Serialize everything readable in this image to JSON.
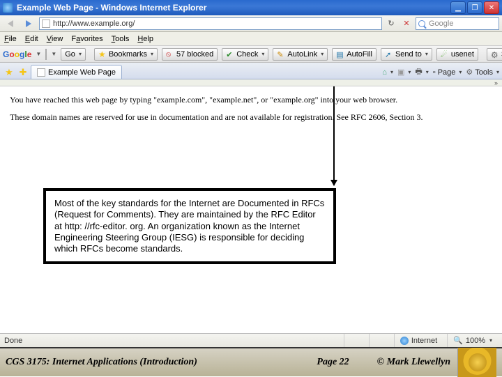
{
  "window": {
    "title": "Example Web Page - Windows Internet Explorer"
  },
  "address": {
    "url": "http://www.example.org/",
    "search_placeholder": "Google"
  },
  "menu": {
    "file": "File",
    "edit": "Edit",
    "view": "View",
    "favorites": "Favorites",
    "tools": "Tools",
    "help": "Help"
  },
  "gtoolbar": {
    "go": "Go",
    "bookmarks": "Bookmarks",
    "blocked": "57 blocked",
    "check": "Check",
    "autolink": "AutoLink",
    "autofill": "AutoFill",
    "sendto": "Send to",
    "usenet": "usenet",
    "settings": "Settings"
  },
  "tab": {
    "label": "Example Web Page",
    "page_btn": "Page",
    "tools_btn": "Tools"
  },
  "page": {
    "p1": "You have reached this web page by typing \"example.com\", \"example.net\", or \"example.org\" into your web browser.",
    "p2": "These domain names are reserved for use in documentation and are not available for registration. See RFC 2606, Section 3."
  },
  "callout": {
    "text": "Most of the key standards for the Internet are Documented in RFCs (Request for Comments).  They are maintained by the RFC Editor at http: //rfc-editor. org.  An organization known as the Internet Engineering Steering Group (IESG) is responsible for deciding which RFCs become standards."
  },
  "status": {
    "left": "Done",
    "zone": "Internet",
    "zoom": "100%"
  },
  "footer": {
    "course": "CGS 3175: Internet Applications (Introduction)",
    "page": "Page 22",
    "author": "© Mark Llewellyn"
  }
}
